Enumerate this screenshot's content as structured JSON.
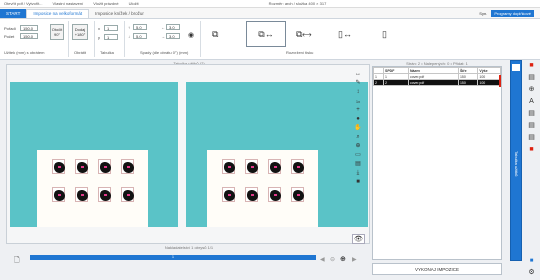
{
  "titlebar": {
    "items": [
      "Otevřít pdf / Vytvořit...",
      "Vlastní nastavení",
      "Vložit prázdné",
      "Uložit"
    ],
    "center": "Rozměr: arch / složka 400 × 317",
    "right_badge": "Programy doplňkové",
    "sync": "Syn."
  },
  "tabs": [
    "START",
    "Imposice na velkoformát",
    "Imposice knížek / brožur"
  ],
  "ribbon": {
    "poradi_label": "Pořadí",
    "poradi_value": "150.0",
    "pocet_label": "Počet",
    "pocet_value": "150.0",
    "rotate_btn": "Otočit 90°",
    "rotate_btn2": "Dodaj +180°",
    "group1": "Užitek (mm) s obrátem",
    "group2": "Obrátit",
    "group3": "Tabulka",
    "group4": "Spady (dle obrátu 0°) (mm)",
    "group5": "Rozvržení tisku",
    "spady": [
      "5.0",
      "5.0",
      "3.0",
      "3.0"
    ],
    "spady_labels": [
      "↑",
      "↓",
      "←",
      "→"
    ]
  },
  "left_panel": {
    "title": "Tabulka užitků (2)",
    "bottom_label": "Nakladatelství 1 obrysů 1/1"
  },
  "right_panel": {
    "title": "Strán: 2 • Nalepených: 0 • Přidat: 1",
    "columns": [
      "",
      "SPDF",
      "Název",
      "Šíře",
      "Výše"
    ],
    "rows": [
      [
        "1",
        "1",
        "cover.pdf",
        "150",
        "100"
      ],
      [
        "2",
        "2",
        "cover.pdf",
        "150",
        "100"
      ]
    ],
    "execute_label": "VYKONAJ IMPOZICE"
  },
  "vertical_label": "Tabulka užitků",
  "progress": {
    "label": "1",
    "value": 1.0
  },
  "tools": [
    "↔",
    "✎",
    "↕",
    "1x",
    "+",
    "●",
    "✋",
    "⌕",
    "⊕",
    "▭",
    "▤",
    "⤓",
    "■",
    "👁"
  ],
  "side_icons": [
    "■",
    "▤",
    "⊕",
    "A",
    "▤",
    "▤",
    "▤",
    "■",
    "⚙"
  ]
}
